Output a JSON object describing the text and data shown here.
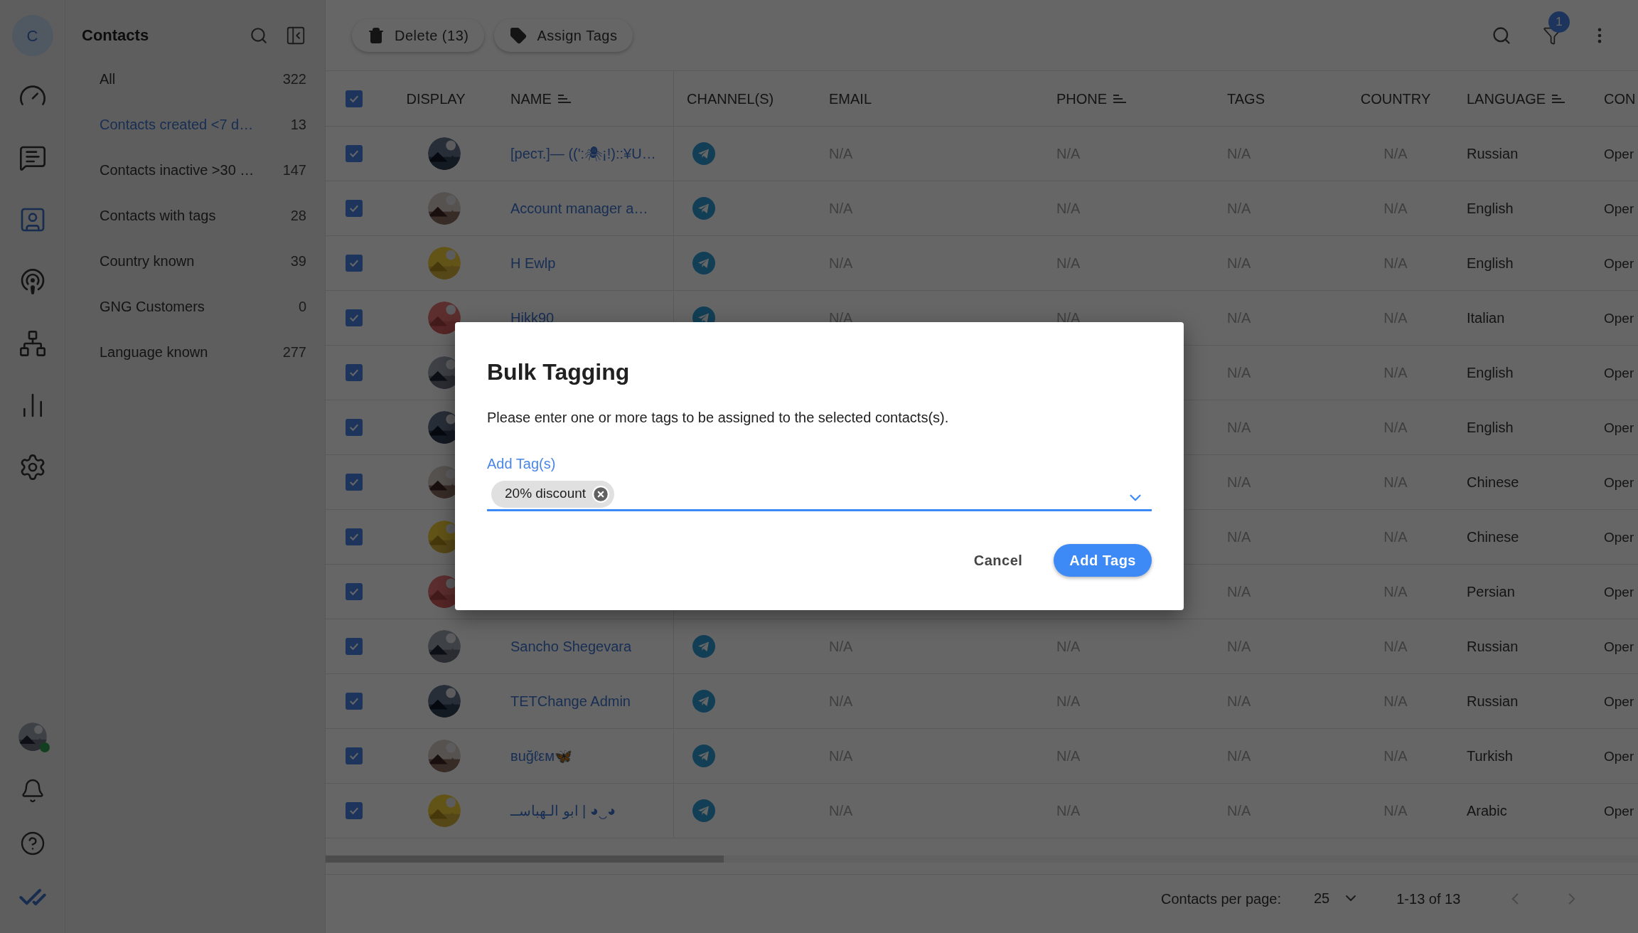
{
  "rail": {
    "account_letter": "C",
    "items": [
      {
        "kind": "dashboard",
        "selected": false
      },
      {
        "kind": "chat",
        "selected": false
      },
      {
        "kind": "contacts",
        "selected": true
      },
      {
        "kind": "broadcast",
        "selected": false
      },
      {
        "kind": "flows",
        "selected": false
      },
      {
        "kind": "reports",
        "selected": false
      },
      {
        "kind": "settings",
        "selected": false
      }
    ],
    "user": {
      "online": true
    },
    "bottom_items": [
      {
        "kind": "notifications"
      },
      {
        "kind": "help"
      },
      {
        "kind": "logo"
      }
    ]
  },
  "contacts_panel": {
    "title": "Contacts",
    "lists": [
      {
        "label": "All",
        "count": "322",
        "selected": false
      },
      {
        "label": "Contacts created <7 d…",
        "count": "13",
        "selected": true
      },
      {
        "label": "Contacts inactive >30 …",
        "count": "147",
        "selected": false
      },
      {
        "label": "Contacts with tags",
        "count": "28",
        "selected": false
      },
      {
        "label": "Country known",
        "count": "39",
        "selected": false
      },
      {
        "label": "GNG Customers",
        "count": "0",
        "selected": false
      },
      {
        "label": "Language known",
        "count": "277",
        "selected": false
      }
    ]
  },
  "toolbar": {
    "buttons": [
      {
        "kind": "delete",
        "label": "Delete (13)"
      },
      {
        "kind": "tag",
        "label": "Assign Tags"
      }
    ],
    "filter_badge": "1"
  },
  "table": {
    "select_all": true,
    "columns": [
      {
        "label": "DISPLAY",
        "sortable": false
      },
      {
        "label": "NAME",
        "sortable": true
      },
      {
        "label": "CHANNEL(S)",
        "sortable": false
      },
      {
        "label": "EMAIL",
        "sortable": false
      },
      {
        "label": "PHONE",
        "sortable": true
      },
      {
        "label": "TAGS",
        "sortable": false
      },
      {
        "label": "COUNTRY",
        "sortable": false
      },
      {
        "label": "LANGUAGE",
        "sortable": true
      },
      {
        "label": "CON"
      }
    ],
    "rows": [
      {
        "checked": true,
        "avatar": {
          "kind": "picture"
        },
        "name": "[рест.]— ((':🕷¡!)::¥U…",
        "channels": [
          {
            "kind": "telegram"
          }
        ],
        "email": "N/A",
        "phone": "N/A",
        "tags": "N/A",
        "country": "N/A",
        "language": "Russian",
        "column_10": "Oper"
      },
      {
        "checked": true,
        "avatar": {
          "kind": "picture"
        },
        "name": "Account manager a…",
        "channels": [
          {
            "kind": "telegram"
          }
        ],
        "email": "N/A",
        "phone": "N/A",
        "tags": "N/A",
        "country": "N/A",
        "language": "English",
        "column_10": "Oper"
      },
      {
        "checked": true,
        "avatar": {
          "kind": "picture"
        },
        "name": "H Ewlp",
        "channels": [
          {
            "kind": "telegram"
          }
        ],
        "email": "N/A",
        "phone": "N/A",
        "tags": "N/A",
        "country": "N/A",
        "language": "English",
        "column_10": "Oper"
      },
      {
        "checked": true,
        "avatar": {
          "kind": "picture"
        },
        "name": "Hikk90",
        "channels": [
          {
            "kind": "telegram"
          }
        ],
        "email": "N/A",
        "phone": "N/A",
        "tags": "N/A",
        "country": "N/A",
        "language": "Italian",
        "column_10": "Oper"
      },
      {
        "checked": true,
        "avatar": {
          "kind": "picture"
        },
        "tags": "N/A",
        "country": "N/A",
        "language": "English",
        "column_10": "Oper"
      },
      {
        "checked": true,
        "avatar": {
          "kind": "picture"
        },
        "tags": "N/A",
        "country": "N/A",
        "language": "English",
        "column_10": "Oper"
      },
      {
        "checked": true,
        "avatar": {
          "kind": "picture"
        },
        "tags": "N/A",
        "country": "N/A",
        "language": "Chinese",
        "column_10": "Oper"
      },
      {
        "checked": true,
        "avatar": {
          "kind": "picture"
        },
        "tags": "N/A",
        "country": "N/A",
        "language": "Chinese",
        "column_10": "Oper"
      },
      {
        "checked": true,
        "avatar": {
          "kind": "picture"
        },
        "tags": "N/A",
        "country": "N/A",
        "language": "Persian",
        "column_10": "Oper"
      },
      {
        "checked": true,
        "avatar": {
          "kind": "picture"
        },
        "name": "Sancho Shegevara",
        "channels": [
          {
            "kind": "telegram"
          }
        ],
        "email": "N/A",
        "phone": "N/A",
        "tags": "N/A",
        "country": "N/A",
        "language": "Russian",
        "column_10": "Oper"
      },
      {
        "checked": true,
        "avatar": {
          "kind": "picture"
        },
        "name": "TETChange Admin",
        "channels": [
          {
            "kind": "telegram"
          }
        ],
        "email": "N/A",
        "phone": "N/A",
        "tags": "N/A",
        "country": "N/A",
        "language": "Russian",
        "column_10": "Oper"
      },
      {
        "checked": true,
        "avatar": {
          "kind": "picture"
        },
        "name": "вuğℓεм🦋",
        "channels": [
          {
            "kind": "telegram"
          }
        ],
        "email": "N/A",
        "phone": "N/A",
        "tags": "N/A",
        "country": "N/A",
        "language": "Turkish",
        "column_10": "Oper"
      },
      {
        "checked": true,
        "avatar": {
          "kind": "picture"
        },
        "name": "ابو الـهباســ | ◕‿◕",
        "channels": [
          {
            "kind": "telegram"
          }
        ],
        "email": "N/A",
        "phone": "N/A",
        "tags": "N/A",
        "country": "N/A",
        "language": "Arabic",
        "column_10": "Oper"
      }
    ]
  },
  "footer": {
    "per_page_label": "Contacts per page:",
    "per_page": "25",
    "range": "1-13 of 13"
  },
  "dialog": {
    "title": "Bulk Tagging",
    "message": "Please enter one or more tags to be assigned to the selected contacts(s).",
    "field_label": "Add Tag(s)",
    "chips": [
      {
        "label": "20% discount"
      }
    ],
    "buttons": [
      {
        "kind": "text",
        "label": "Cancel"
      },
      {
        "kind": "primary",
        "label": "Add Tags"
      }
    ]
  }
}
